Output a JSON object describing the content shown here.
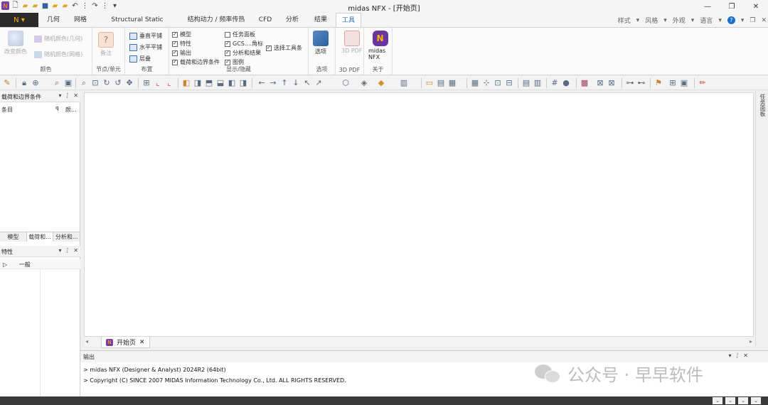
{
  "window": {
    "title": "midas NFX - [开始页]",
    "controls": [
      "—",
      "❐",
      "✕"
    ]
  },
  "quick_access": [
    "logo-icon",
    "new-icon",
    "open-icon",
    "open-folder-icon",
    "save-icon",
    "saveas-icon",
    "export-icon",
    "undo-icon",
    "redo-icon",
    "customize-icon"
  ],
  "tabs": {
    "items": [
      {
        "label": "几何"
      },
      {
        "label": "网格"
      },
      {
        "label": "Structural Static Analysis"
      },
      {
        "label": "结构动力 / 频率传热"
      },
      {
        "label": "CFD"
      },
      {
        "label": "分析"
      },
      {
        "label": "结果"
      },
      {
        "label": "工具"
      }
    ],
    "active": "工具",
    "right": [
      "样式",
      "风格",
      "外观",
      "语言"
    ]
  },
  "ribbon": {
    "group_color": {
      "label": "颜色",
      "change_color": "改变颜色",
      "random_geo": "随机颜色(几何)",
      "random_mesh": "随机颜色(网格)"
    },
    "group_node": {
      "label": "节点/单元",
      "note": "备注"
    },
    "group_layout": {
      "label": "布置",
      "vertical": "垂直平铺",
      "horizontal": "水平平铺",
      "cascade": "层叠"
    },
    "group_display": {
      "label": "显示/隐藏",
      "col1": [
        "模型",
        "特性",
        "输出",
        "载荷和边界条件"
      ],
      "col2": [
        "任务面板",
        "GCS....角标",
        "分析和结果",
        "图例"
      ],
      "col1_checked": [
        true,
        true,
        true,
        true
      ],
      "col2_checked": [
        false,
        true,
        true,
        true
      ],
      "select_toolbar": "选择工具条"
    },
    "group_options": {
      "label": "选项",
      "button": "选项"
    },
    "group_3dpdf": {
      "label": "3D PDF",
      "button": "3D PDF"
    },
    "group_about": {
      "label": "关于",
      "button": "midas NFX"
    }
  },
  "left_panels": {
    "tree": {
      "title": "载荷和边界条件",
      "col_item": "条目",
      "col_color": "颜..."
    },
    "bottom_tabs": [
      "模型",
      "载荷和...",
      "分析和..."
    ],
    "properties": {
      "title": "特性",
      "row": "一般"
    }
  },
  "document_tab": {
    "label": "开始页"
  },
  "right_strip": {
    "label": "任务面板"
  },
  "output": {
    "title": "输出",
    "lines": [
      "> midas NFX (Designer & Analyst) 2024R2 (64bit)",
      "> Copyright (C) SINCE 2007 MIDAS Information Technology Co., Ltd. ALL RIGHTS RESERVED."
    ]
  },
  "watermark": {
    "text": "公众号 · 早早软件"
  },
  "colors": {
    "accent": "#2f6db5",
    "app_menu": "#2b2b2b",
    "logo": "#7a3fa0",
    "status_bar": "#3a3a3a"
  }
}
